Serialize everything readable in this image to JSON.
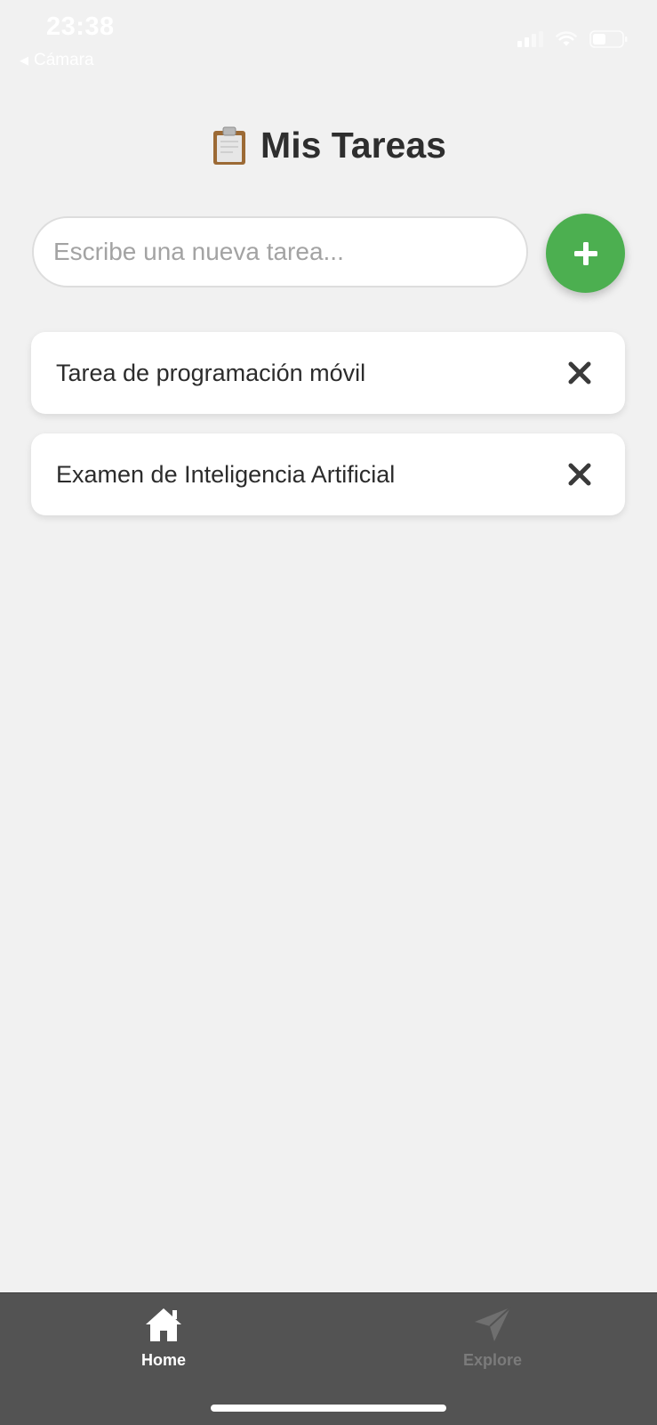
{
  "status_bar": {
    "time": "23:38",
    "back_label": "Cámara",
    "back_arrow": "◀"
  },
  "header": {
    "title": "Mis Tareas",
    "icon": "clipboard-icon"
  },
  "new_task": {
    "value": "",
    "placeholder": "Escribe una nueva tarea...",
    "add_icon": "plus-icon",
    "accent_color": "#4caf50"
  },
  "tasks": [
    {
      "text": "Tarea de programación móvil",
      "delete_icon": "close-icon"
    },
    {
      "text": "Examen de Inteligencia Artificial",
      "delete_icon": "close-icon"
    }
  ],
  "tab_bar": {
    "background": "#535353",
    "tabs": [
      {
        "label": "Home",
        "icon": "home-icon",
        "active": true
      },
      {
        "label": "Explore",
        "icon": "send-icon",
        "active": false
      }
    ]
  }
}
